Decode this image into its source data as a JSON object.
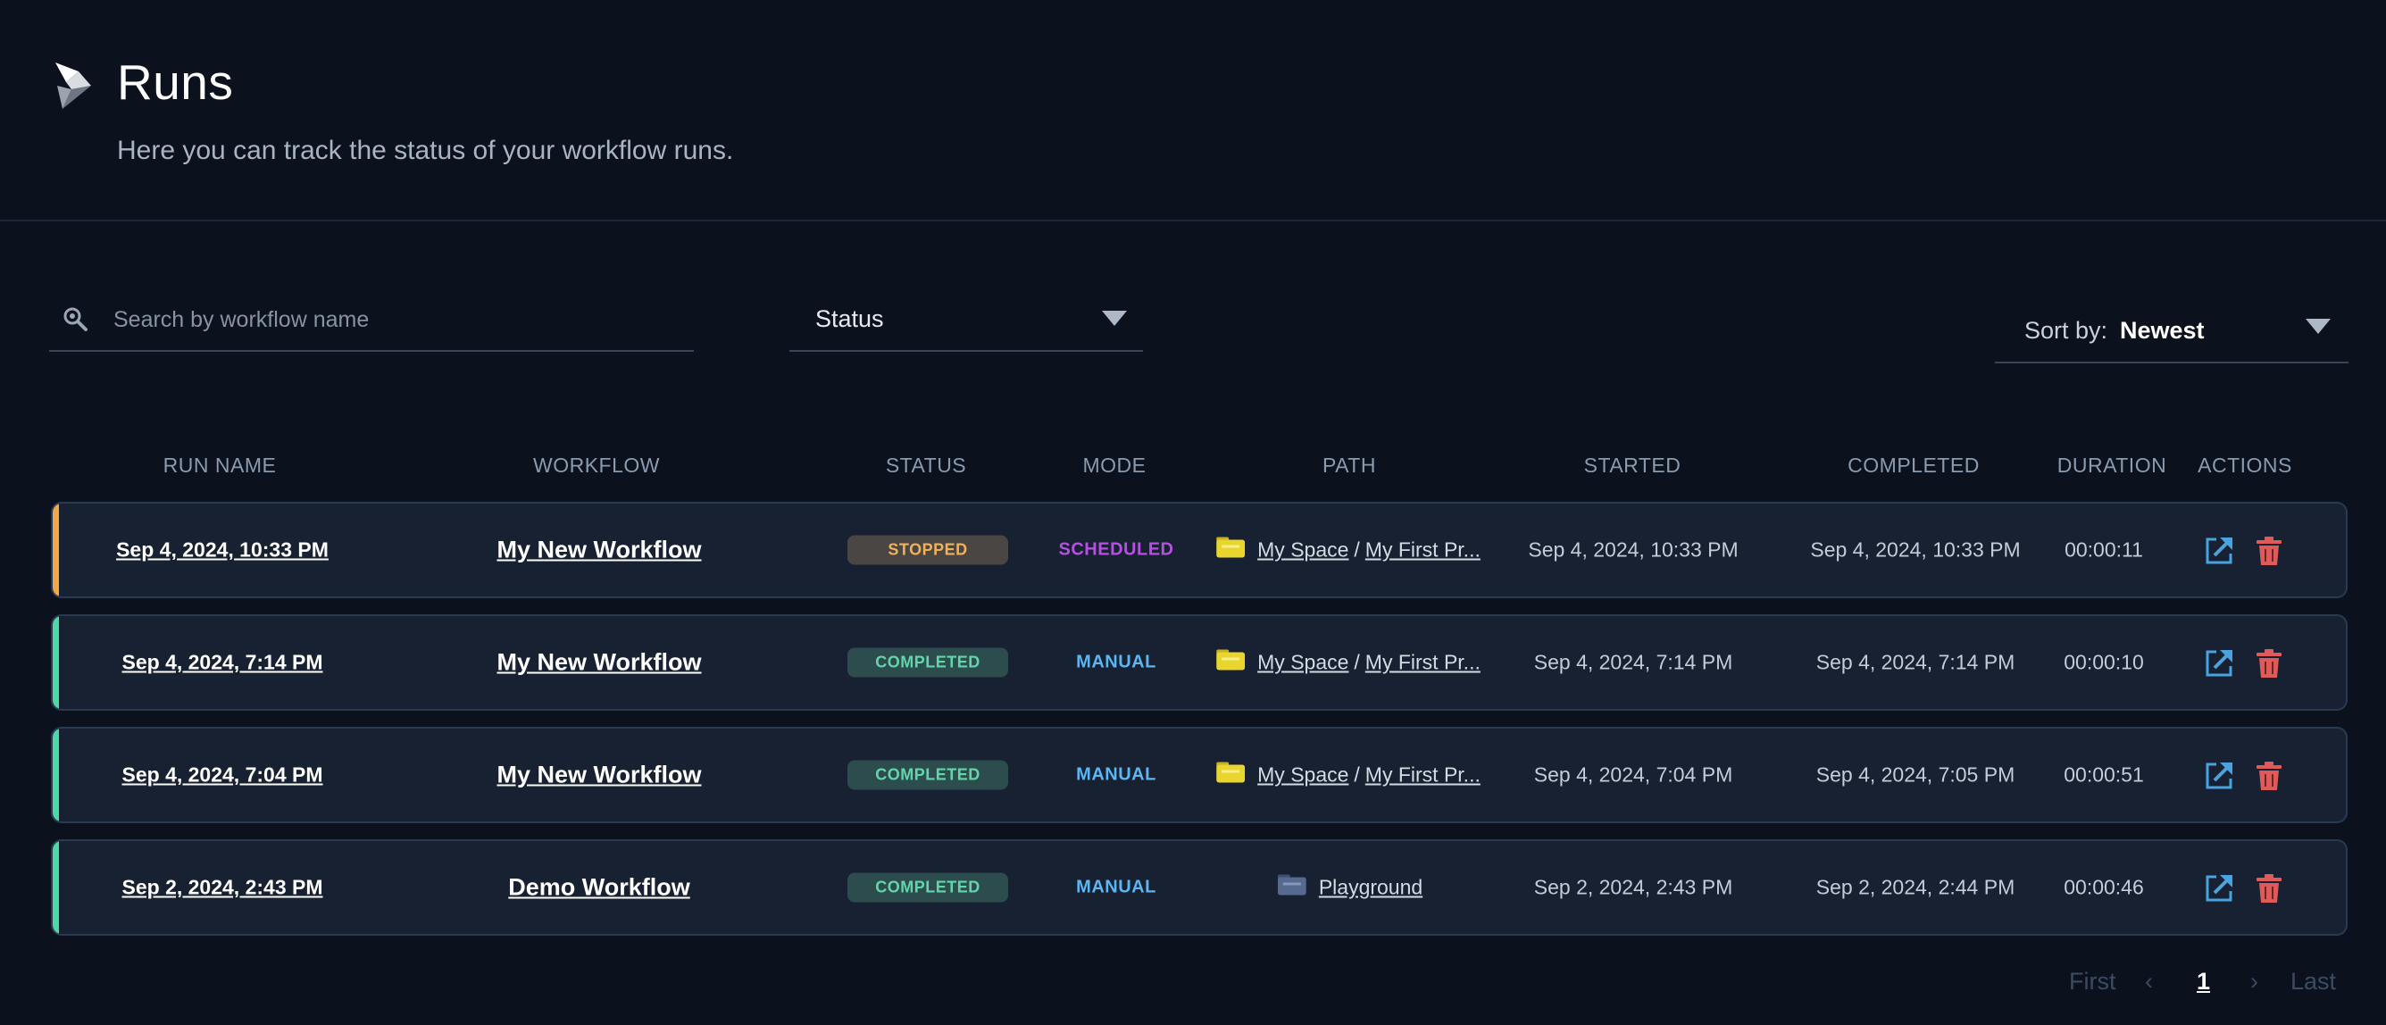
{
  "header": {
    "title": "Runs",
    "subtitle": "Here you can track the status of your workflow runs."
  },
  "filters": {
    "search_placeholder": "Search by workflow name",
    "status_label": "Status",
    "sort_label": "Sort by:",
    "sort_value": "Newest"
  },
  "table": {
    "columns": [
      "RUN NAME",
      "WORKFLOW",
      "STATUS",
      "MODE",
      "PATH",
      "STARTED",
      "COMPLETED",
      "DURATION",
      "ACTIONS"
    ],
    "rows": [
      {
        "run_name": "Sep 4, 2024, 10:33 PM",
        "workflow": "My New Workflow",
        "status": "STOPPED",
        "mode": "SCHEDULED",
        "path": [
          "My Space",
          "My First Pr..."
        ],
        "path_sep": "/",
        "started": "Sep 4, 2024, 10:33 PM",
        "completed": "Sep 4, 2024, 10:33 PM",
        "duration": "00:00:11",
        "accent": "#f0a94a"
      },
      {
        "run_name": "Sep 4, 2024, 7:14 PM",
        "workflow": "My New Workflow",
        "status": "COMPLETED",
        "mode": "MANUAL",
        "path": [
          "My Space",
          "My First Pr..."
        ],
        "path_sep": "/",
        "started": "Sep 4, 2024, 7:14 PM",
        "completed": "Sep 4, 2024, 7:14 PM",
        "duration": "00:00:10",
        "accent": "#4fd7a6"
      },
      {
        "run_name": "Sep 4, 2024, 7:04 PM",
        "workflow": "My New Workflow",
        "status": "COMPLETED",
        "mode": "MANUAL",
        "path": [
          "My Space",
          "My First Pr..."
        ],
        "path_sep": "/",
        "started": "Sep 4, 2024, 7:04 PM",
        "completed": "Sep 4, 2024, 7:05 PM",
        "duration": "00:00:51",
        "accent": "#4fd7a6"
      },
      {
        "run_name": "Sep 2, 2024, 2:43 PM",
        "workflow": "Demo Workflow",
        "status": "COMPLETED",
        "mode": "MANUAL",
        "path": [
          "Playground"
        ],
        "path_sep": "",
        "started": "Sep 2, 2024, 2:43 PM",
        "completed": "Sep 2, 2024, 2:44 PM",
        "duration": "00:00:46",
        "accent": "#4fd7a6"
      }
    ]
  },
  "icons": {
    "logo": "play-logo-icon",
    "search": "search-icon",
    "folder_space": "yellow-folder-icon",
    "folder_playground": "blue-folder-icon",
    "open": "open-external-icon",
    "delete": "trash-icon"
  },
  "colors": {
    "background": "#0b111d",
    "row_bg": "#172131",
    "stopped": "#f0b15a",
    "completed": "#62d6aa",
    "scheduled": "#b74fe3",
    "manual": "#5db6f2",
    "open_icon": "#4aa3e0",
    "delete_icon": "#e05a5a"
  },
  "pagination": {
    "first": "First",
    "prev": "‹",
    "current": "1",
    "next": "›",
    "last": "Last"
  }
}
